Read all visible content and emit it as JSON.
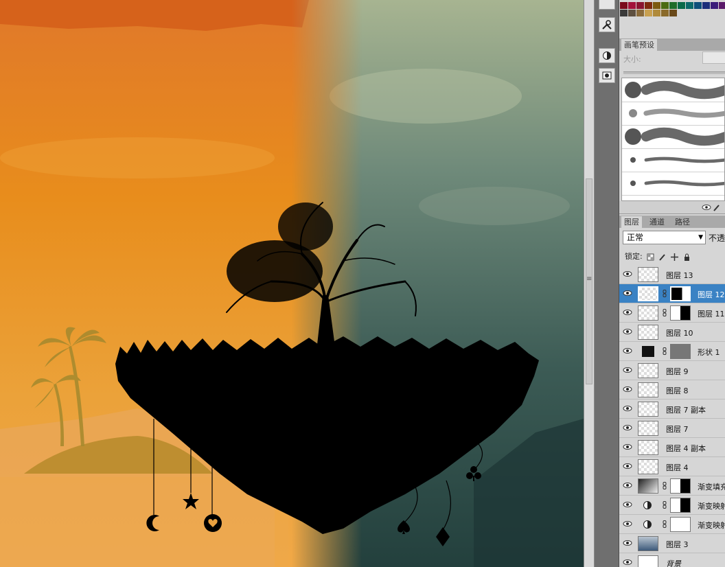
{
  "brushes_panel": {
    "tab_label": "画笔预设",
    "size_label": "大小:"
  },
  "layers_panel": {
    "tabs": [
      "图层",
      "通道",
      "路径"
    ],
    "blend_mode": "正常",
    "opacity_label": "不透",
    "lock_label": "锁定:",
    "layers": [
      {
        "name": "图层 13",
        "selected": false,
        "mask": false
      },
      {
        "name": "图层 12",
        "selected": true,
        "mask": true
      },
      {
        "name": "图层 11",
        "selected": false,
        "mask": true
      },
      {
        "name": "图层 10",
        "selected": false,
        "mask": false
      },
      {
        "name": "形状 1",
        "selected": false,
        "mask": true
      },
      {
        "name": "图层 9",
        "selected": false,
        "mask": false
      },
      {
        "name": "图层 8",
        "selected": false,
        "mask": false
      },
      {
        "name": "图层 7 副本",
        "selected": false,
        "mask": false
      },
      {
        "name": "图层 7",
        "selected": false,
        "mask": false
      },
      {
        "name": "图层 4 副本",
        "selected": false,
        "mask": false
      },
      {
        "name": "图层 4",
        "selected": false,
        "mask": false
      },
      {
        "name": "渐变填充",
        "selected": false,
        "mask": true
      },
      {
        "name": "渐变映射",
        "selected": false,
        "mask": true
      },
      {
        "name": "渐变映射",
        "selected": false,
        "mask": true
      },
      {
        "name": "图层 3",
        "selected": false,
        "mask": false
      },
      {
        "name": "背景",
        "selected": false,
        "mask": false
      }
    ]
  },
  "tools": [
    "wrench-screwdriver-icon",
    "half-circle-icon",
    "quick-mask-icon"
  ],
  "colors": {
    "selection": "#3a82c4",
    "sky_warm": "#e8921f",
    "sky_cool": "#3f5c55"
  }
}
